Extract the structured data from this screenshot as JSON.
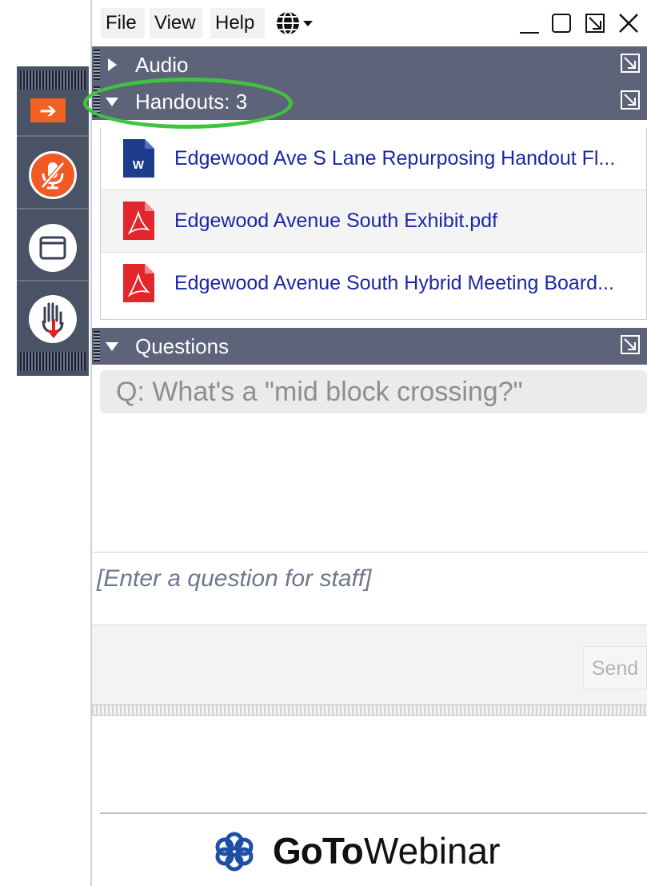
{
  "menubar": {
    "file": "File",
    "view": "View",
    "help": "Help",
    "language_icon": "globe-icon"
  },
  "window_controls": [
    "minimize-icon",
    "maximize-icon",
    "popout-icon",
    "close-icon"
  ],
  "grab_tab": {
    "buttons": [
      "collapse-arrow-icon",
      "muted-microphone-icon",
      "screen-view-icon",
      "raise-hand-icon"
    ],
    "colors": {
      "accent": "#f15a24",
      "background": "#4a5266"
    }
  },
  "sections": {
    "audio": {
      "title": "Audio",
      "expanded": false
    },
    "handouts": {
      "title": "Handouts: 3",
      "expanded": true
    },
    "questions": {
      "title": "Questions",
      "expanded": true
    }
  },
  "handouts": [
    {
      "name": "Edgewood Ave S Lane Repurposing Handout Fl...",
      "icon": "word-document-icon"
    },
    {
      "name": "Edgewood Avenue South Exhibit.pdf",
      "icon": "pdf-icon"
    },
    {
      "name": "Edgewood Avenue South Hybrid Meeting Board...",
      "icon": "pdf-icon"
    }
  ],
  "questions": {
    "asked": "Q: What's a \"mid block crossing?\"",
    "input_placeholder": "[Enter a question for staff]",
    "send_label": "Send"
  },
  "brand": {
    "goto": "GoTo",
    "webinar": "Webinar",
    "logo_color": "#1e4fa8",
    "highlight_color": "#3ec43e"
  }
}
